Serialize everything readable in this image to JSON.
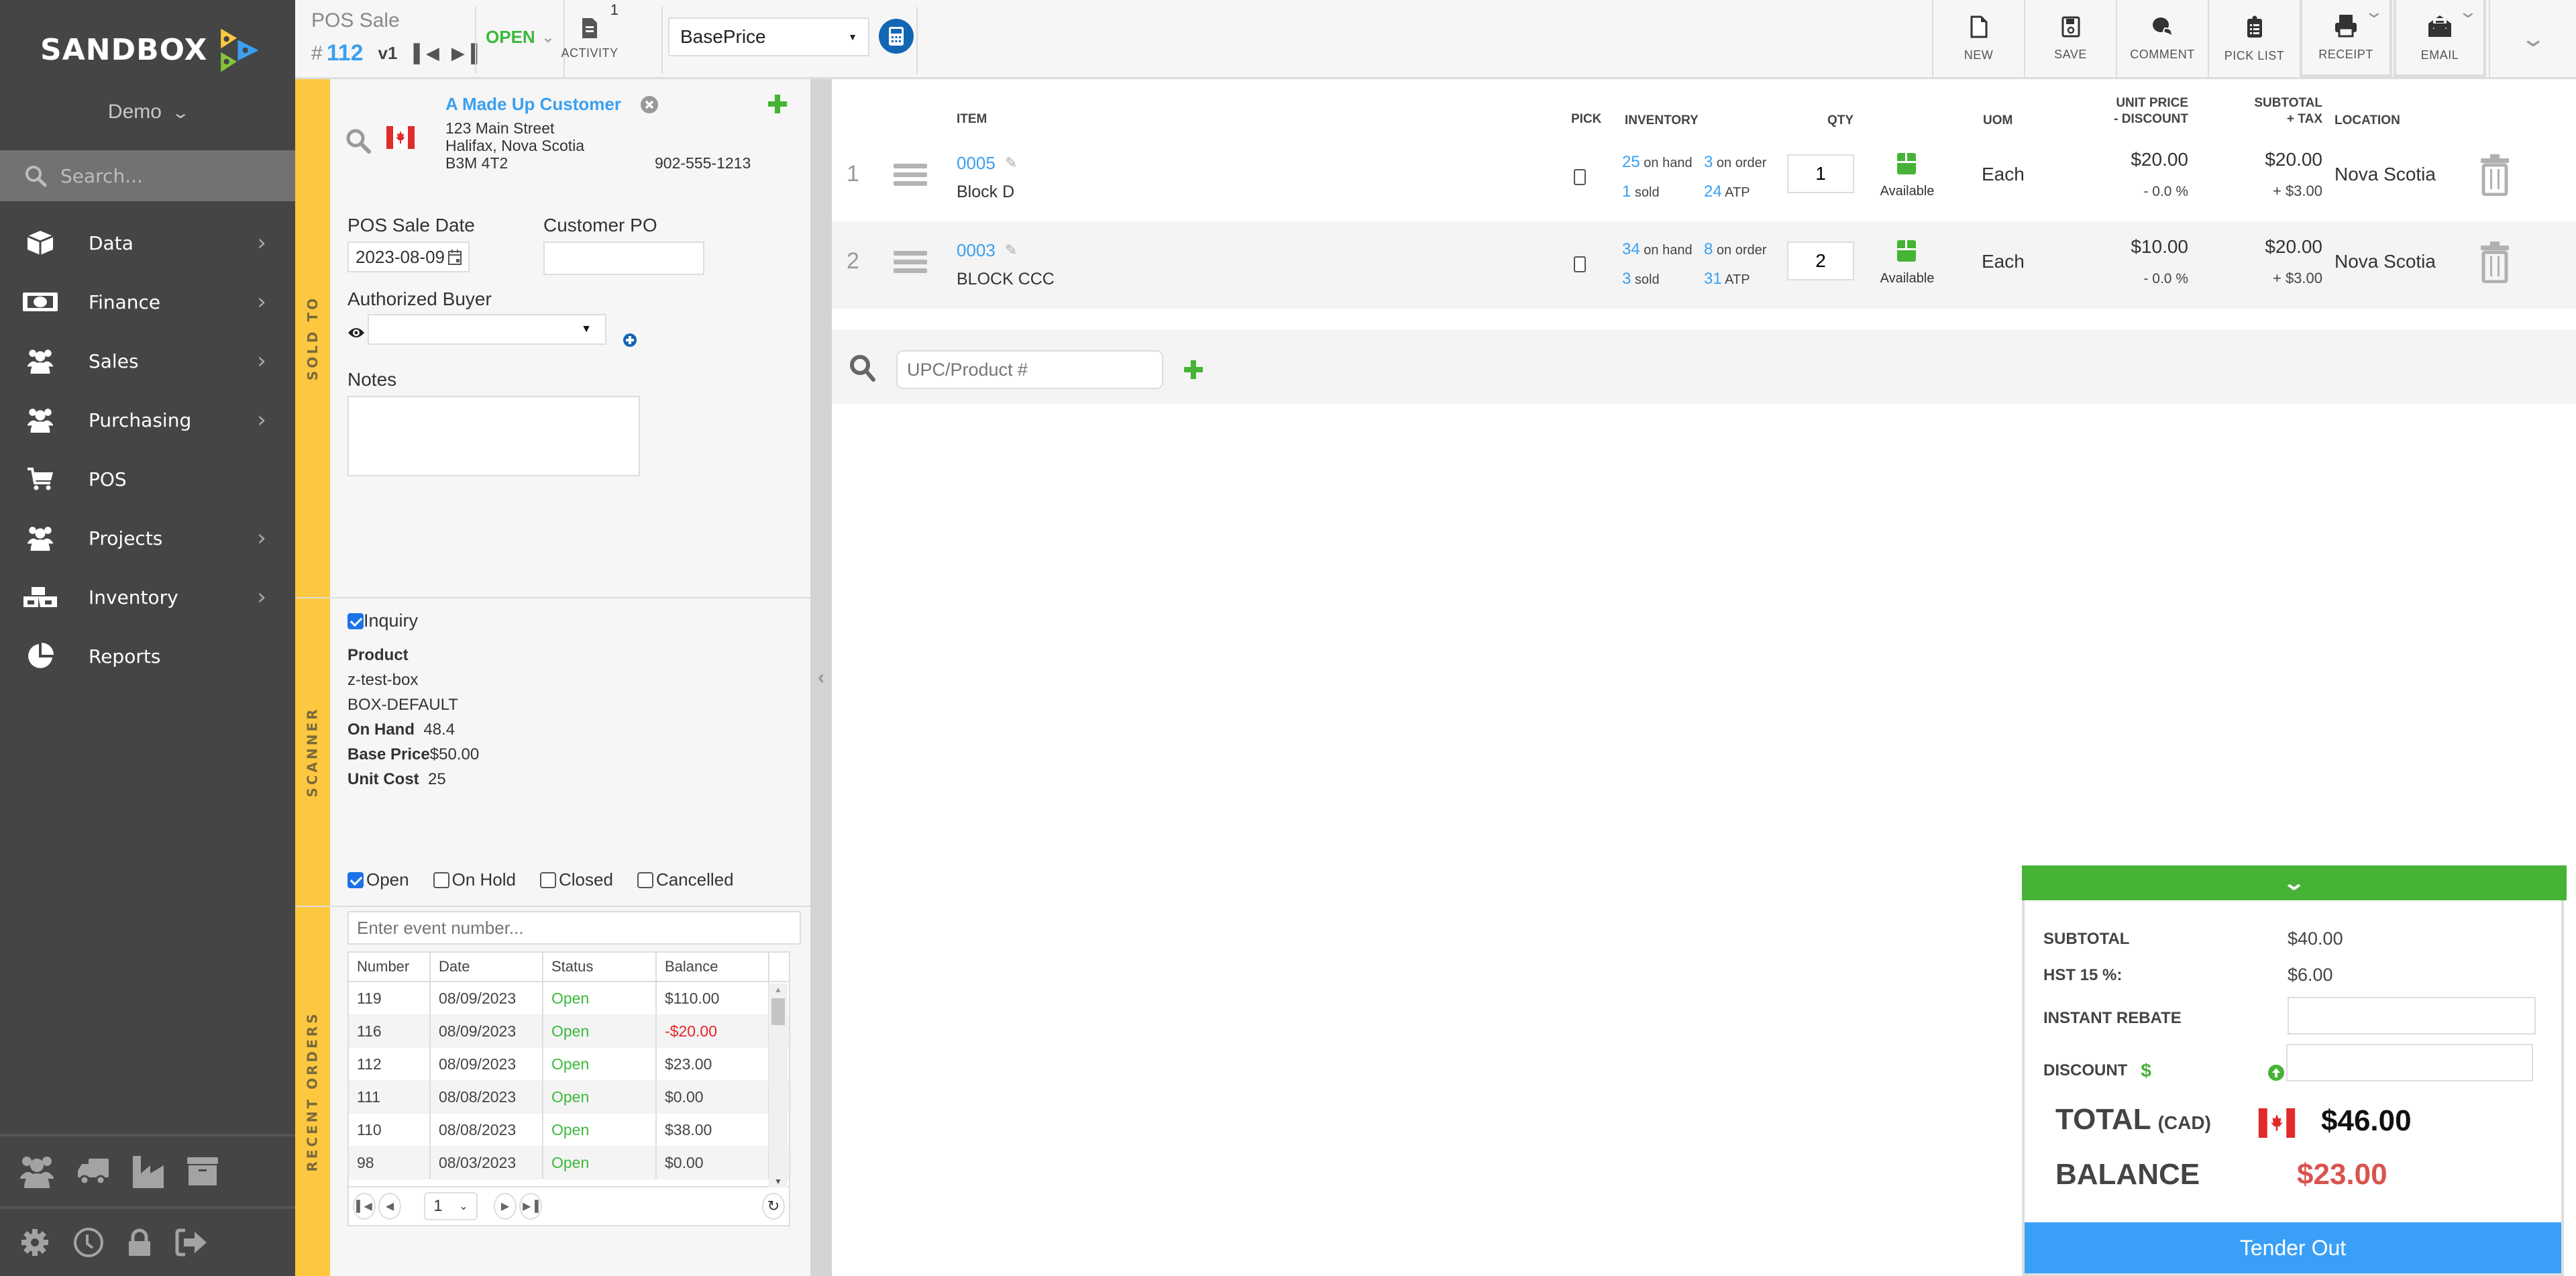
{
  "sidebar": {
    "logo_text": "SANDBOX",
    "company": "Demo",
    "search_placeholder": "Search...",
    "items": [
      {
        "label": "Data",
        "icon": "cube-icon",
        "has_submenu": true
      },
      {
        "label": "Finance",
        "icon": "money-bill-icon",
        "has_submenu": true
      },
      {
        "label": "Sales",
        "icon": "users-icon",
        "has_submenu": true
      },
      {
        "label": "Purchasing",
        "icon": "users-icon",
        "has_submenu": true
      },
      {
        "label": "POS",
        "icon": "shopping-cart-icon",
        "has_submenu": false
      },
      {
        "label": "Projects",
        "icon": "users-icon",
        "has_submenu": true
      },
      {
        "label": "Inventory",
        "icon": "cubes-icon",
        "has_submenu": true
      },
      {
        "label": "Reports",
        "icon": "pie-chart-icon",
        "has_submenu": false
      }
    ],
    "shortcuts": [
      "users-icon",
      "truck-icon",
      "industry-icon",
      "archive-icon"
    ],
    "utilities": [
      "gear-icon",
      "clock-icon",
      "lock-icon",
      "sign-out-icon"
    ]
  },
  "topbar": {
    "doc_type": "POS Sale",
    "hash": "#",
    "doc_number": "112",
    "version": "v1",
    "status": "OPEN",
    "activity_label": "ACTIVITY",
    "activity_count": "1",
    "price_list": "BasePrice",
    "actions": [
      {
        "label": "NEW",
        "icon": "file-icon"
      },
      {
        "label": "SAVE",
        "icon": "save-icon"
      },
      {
        "label": "COMMENT",
        "icon": "comments-icon"
      },
      {
        "label": "PICK LIST",
        "icon": "clipboard-list-icon"
      },
      {
        "label": "RECEIPT",
        "icon": "print-icon"
      },
      {
        "label": "EMAIL",
        "icon": "envelope-open-icon"
      }
    ]
  },
  "sold_to": {
    "section_label": "SOLD TO",
    "customer_name": "A Made Up Customer",
    "address_line1": "123 Main Street",
    "address_line2": "Halifax, Nova Scotia",
    "postal_code": "B3M 4T2",
    "phone": "902-555-1213",
    "sale_date_label": "POS Sale Date",
    "sale_date": "2023-08-09",
    "customer_po_label": "Customer PO",
    "customer_po": "",
    "authorized_buyer_label": "Authorized Buyer",
    "authorized_buyer": "",
    "notes_label": "Notes",
    "notes": ""
  },
  "scanner": {
    "section_label": "SCANNER",
    "inquiry_label": "Inquiry",
    "inquiry_checked": true,
    "product_heading": "Product",
    "product_name": "z-test-box",
    "product_variant": "BOX-DEFAULT",
    "on_hand_label": "On Hand",
    "on_hand": "48.4",
    "base_price_label": "Base Price",
    "base_price": "$50.00",
    "unit_cost_label": "Unit Cost",
    "unit_cost": "25"
  },
  "recent_orders": {
    "section_label": "RECENT ORDERS",
    "filters": [
      {
        "label": "Open",
        "checked": true
      },
      {
        "label": "On Hold",
        "checked": false
      },
      {
        "label": "Closed",
        "checked": false
      },
      {
        "label": "Cancelled",
        "checked": false
      }
    ],
    "search_placeholder": "Enter event number...",
    "columns": [
      "Number",
      "Date",
      "Status",
      "Balance"
    ],
    "rows": [
      {
        "number": "119",
        "date": "08/09/2023",
        "status": "Open",
        "balance": "$110.00",
        "negative": false
      },
      {
        "number": "116",
        "date": "08/09/2023",
        "status": "Open",
        "balance": "-$20.00",
        "negative": true
      },
      {
        "number": "112",
        "date": "08/09/2023",
        "status": "Open",
        "balance": "$23.00",
        "negative": false
      },
      {
        "number": "111",
        "date": "08/08/2023",
        "status": "Open",
        "balance": "$0.00",
        "negative": false
      },
      {
        "number": "110",
        "date": "08/08/2023",
        "status": "Open",
        "balance": "$38.00",
        "negative": false
      },
      {
        "number": "98",
        "date": "08/03/2023",
        "status": "Open",
        "balance": "$0.00",
        "negative": false
      }
    ],
    "page": "1"
  },
  "items_table": {
    "headers": {
      "item": "ITEM",
      "pick": "PICK",
      "inventory": "INVENTORY",
      "qty": "QTY",
      "uom": "UOM",
      "unit_price_1": "UNIT PRICE",
      "unit_price_2": "- DISCOUNT",
      "subtotal_1": "SUBTOTAL",
      "subtotal_2": "+ TAX",
      "location": "LOCATION"
    },
    "rows": [
      {
        "line": "1",
        "sku": "0005",
        "name": "Block D",
        "picked": false,
        "on_hand": "25",
        "on_order": "3",
        "sold": "1",
        "atp": "24",
        "qty": "1",
        "availability": "Available",
        "uom": "Each",
        "unit_price": "$20.00",
        "discount": "- 0.0 %",
        "subtotal": "$20.00",
        "tax": "+ $3.00",
        "location": "Nova Scotia"
      },
      {
        "line": "2",
        "sku": "0003",
        "name": "BLOCK CCC",
        "picked": false,
        "on_hand": "34",
        "on_order": "8",
        "sold": "3",
        "atp": "31",
        "qty": "2",
        "availability": "Available",
        "uom": "Each",
        "unit_price": "$10.00",
        "discount": "- 0.0 %",
        "subtotal": "$20.00",
        "tax": "+ $3.00",
        "location": "Nova Scotia"
      }
    ],
    "inv_labels": {
      "on_hand": "on hand",
      "on_order": "on order",
      "sold": "sold",
      "atp": "ATP"
    },
    "add_placeholder": "UPC/Product #"
  },
  "summary": {
    "subtotal_label": "SUBTOTAL",
    "subtotal": "$40.00",
    "tax_label": "HST 15 %:",
    "tax": "$6.00",
    "rebate_label": "INSTANT REBATE",
    "rebate": "",
    "discount_label": "DISCOUNT",
    "discount_symbol": "$",
    "discount": "",
    "total_label": "TOTAL",
    "currency": "(CAD)",
    "total": "$46.00",
    "balance_label": "BALANCE",
    "balance": "$23.00",
    "tender_label": "Tender Out"
  },
  "colors": {
    "accent_blue": "#3aa0f0",
    "status_green": "#3cb93c",
    "section_yellow": "#fdc840",
    "balance_red": "#d9534f",
    "negative_red": "#e8232a",
    "tender_blue": "#3aa0f7",
    "summary_header_green": "#46b336"
  }
}
